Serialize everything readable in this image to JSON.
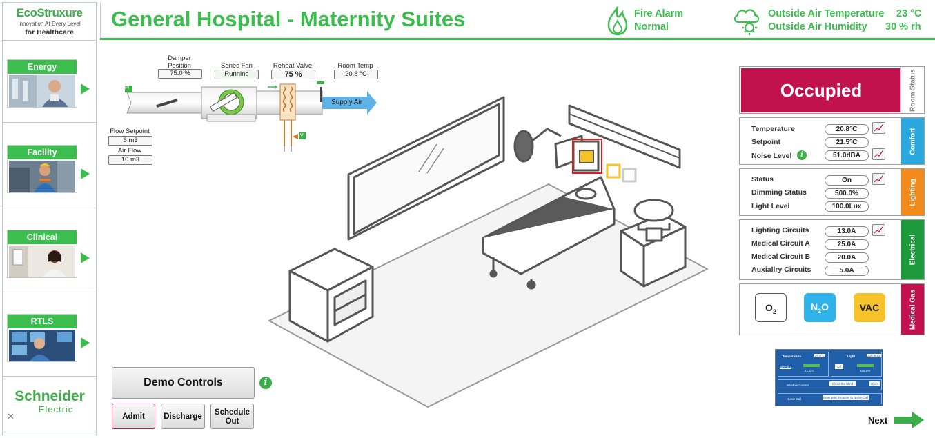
{
  "brand": {
    "eco_logo": "EcoStruxure",
    "tagline": "Innovation At Every Level",
    "subtitle": "for Healthcare",
    "schneider": "Schneider",
    "electric": "Electric"
  },
  "nav": [
    {
      "label": "Energy",
      "icon": "energy-photo"
    },
    {
      "label": "Facility",
      "icon": "facility-photo"
    },
    {
      "label": "Clinical",
      "icon": "clinical-photo"
    },
    {
      "label": "RTLS",
      "icon": "rtls-photo"
    }
  ],
  "header": {
    "title": "General Hospital - Maternity Suites",
    "fire_alarm_label": "Fire Alarm",
    "fire_alarm_status": "Normal",
    "outside_temp_label": "Outside Air Temperature",
    "outside_temp_value": "23 °C",
    "outside_humidity_label": "Outside Air Humidity",
    "outside_humidity_value": "30 % rh",
    "accent_color": "#3cbe4f"
  },
  "hvac": {
    "damper_label": "Damper Position",
    "damper_value": "75.0 %",
    "fan_label": "Series Fan",
    "fan_value": "Running",
    "reheat_label": "Reheat Valve",
    "reheat_value": "75 %",
    "room_temp_label": "Room Temp",
    "room_temp_value": "20.8 °C",
    "supply_air": "Supply Air",
    "flow_setpoint_label": "Flow Setpoint",
    "flow_setpoint_value": "6 m3",
    "air_flow_label": "Air Flow",
    "air_flow_value": "10 m3",
    "fi_tag": "FI",
    "t_tag": "T",
    "v_tag": "V"
  },
  "room_status": {
    "tab": "Room Status",
    "value": "Occupied",
    "color": "#c2124d"
  },
  "comfort": {
    "tab": "Comfort",
    "color": "#2ba7df",
    "rows": [
      {
        "label": "Temperature",
        "value": "20.8°C"
      },
      {
        "label": "Setpoint",
        "value": "21.5°C"
      },
      {
        "label": "Noise Level",
        "value": "51.0dBA"
      }
    ]
  },
  "lighting": {
    "tab": "Lighting",
    "color": "#f28a1c",
    "rows": [
      {
        "label": "Status",
        "value": "On"
      },
      {
        "label": "Dimming Status",
        "value": "500.0%"
      },
      {
        "label": "Light Level",
        "value": "100.0Lux"
      }
    ]
  },
  "electrical": {
    "tab": "Electrical",
    "color": "#1d9b3c",
    "rows": [
      {
        "label": "Lighting Circuits",
        "value": "13.0A"
      },
      {
        "label": "Medical Circuit A",
        "value": "25.0A"
      },
      {
        "label": "Medical Circuit B",
        "value": "20.0A"
      },
      {
        "label": "Auxiallry Circuits",
        "value": "5.0A"
      }
    ]
  },
  "medical_gas": {
    "tab": "Medical Gas",
    "color": "#c2124d",
    "o2": "O",
    "o2_sub": "2",
    "n2o_a": "N",
    "n2o_sub": "2",
    "n2o_b": "O",
    "n2o_color": "#2fb3ea",
    "vac": "VAC",
    "vac_color": "#f6c22a"
  },
  "thumb": {
    "temperature": "Temperature",
    "temp_val": "20.8°C",
    "setpoint": "SetPoint",
    "setpoint_val": "21.5°C",
    "light": "Light",
    "light_val": "100.0Lux",
    "off": "Off",
    "dim_val": "100.0%",
    "window": "Window Control",
    "close_blind": "Close the Blind",
    "open": "Open",
    "nurse": "Nurse Call",
    "emergency": "Emergency Call",
    "routine": "Routine Call",
    "nurse_call_btn": "Nurse Call"
  },
  "demo": {
    "title": "Demo Controls",
    "admit": "Admit",
    "discharge": "Discharge",
    "schedule_out": "Schedule Out"
  },
  "next": "Next"
}
